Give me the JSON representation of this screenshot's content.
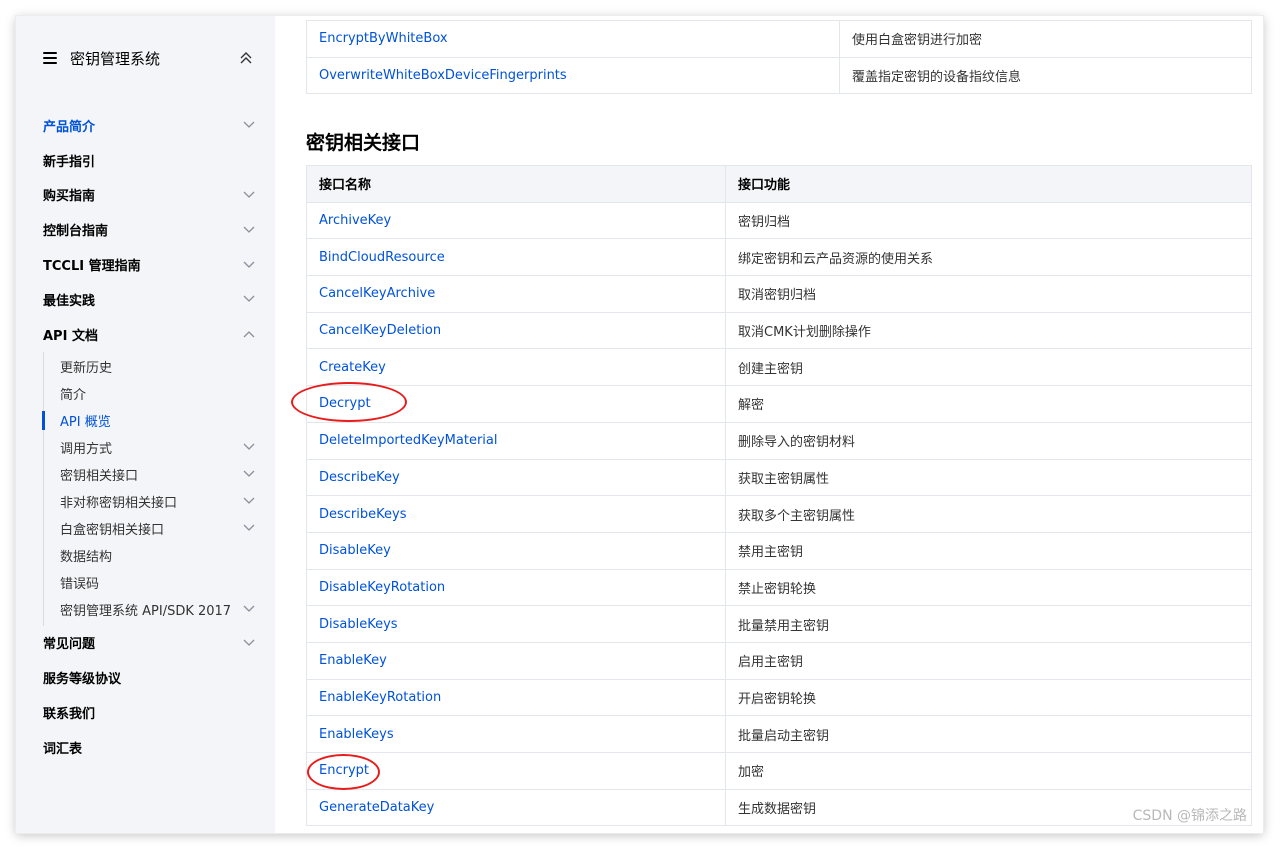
{
  "sidebar": {
    "title": "密钥管理系统",
    "items": [
      {
        "label": "产品简介",
        "active": true,
        "chevron": "down"
      },
      {
        "label": "新手指引",
        "chevron": ""
      },
      {
        "label": "购买指南",
        "chevron": "down"
      },
      {
        "label": "控制台指南",
        "chevron": "down"
      },
      {
        "label": "TCCLI 管理指南",
        "chevron": "down"
      },
      {
        "label": "最佳实践",
        "chevron": "down"
      },
      {
        "label": "API 文档",
        "chevron": "up"
      },
      {
        "label": "常见问题",
        "chevron": "down"
      },
      {
        "label": "服务等级协议",
        "chevron": ""
      },
      {
        "label": "联系我们",
        "chevron": ""
      },
      {
        "label": "词汇表",
        "chevron": ""
      }
    ],
    "api_sub_items": [
      {
        "label": "更新历史",
        "chevron": ""
      },
      {
        "label": "简介",
        "chevron": ""
      },
      {
        "label": "API 概览",
        "active": true,
        "chevron": ""
      },
      {
        "label": "调用方式",
        "chevron": "down"
      },
      {
        "label": "密钥相关接口",
        "chevron": "down"
      },
      {
        "label": "非对称密钥相关接口",
        "chevron": "down"
      },
      {
        "label": "白盒密钥相关接口",
        "chevron": "down"
      },
      {
        "label": "数据结构",
        "chevron": ""
      },
      {
        "label": "错误码",
        "chevron": ""
      },
      {
        "label": "密钥管理系统 API/SDK 2017",
        "chevron": "down"
      }
    ]
  },
  "top_table": {
    "rows": [
      {
        "name": "EncryptByWhiteBox",
        "desc": "使用白盒密钥进行加密"
      },
      {
        "name": "OverwriteWhiteBoxDeviceFingerprints",
        "desc": "覆盖指定密钥的设备指纹信息"
      }
    ]
  },
  "section": {
    "title": "密钥相关接口",
    "columns": [
      "接口名称",
      "接口功能"
    ],
    "rows": [
      {
        "name": "ArchiveKey",
        "desc": "密钥归档"
      },
      {
        "name": "BindCloudResource",
        "desc": "绑定密钥和云产品资源的使用关系"
      },
      {
        "name": "CancelKeyArchive",
        "desc": "取消密钥归档"
      },
      {
        "name": "CancelKeyDeletion",
        "desc": "取消CMK计划删除操作"
      },
      {
        "name": "CreateKey",
        "desc": "创建主密钥"
      },
      {
        "name": "Decrypt",
        "desc": "解密",
        "highlight": true
      },
      {
        "name": "DeleteImportedKeyMaterial",
        "desc": "删除导入的密钥材料"
      },
      {
        "name": "DescribeKey",
        "desc": "获取主密钥属性"
      },
      {
        "name": "DescribeKeys",
        "desc": "获取多个主密钥属性"
      },
      {
        "name": "DisableKey",
        "desc": "禁用主密钥"
      },
      {
        "name": "DisableKeyRotation",
        "desc": "禁止密钥轮换"
      },
      {
        "name": "DisableKeys",
        "desc": "批量禁用主密钥"
      },
      {
        "name": "EnableKey",
        "desc": "启用主密钥"
      },
      {
        "name": "EnableKeyRotation",
        "desc": "开启密钥轮换"
      },
      {
        "name": "EnableKeys",
        "desc": "批量启动主密钥"
      },
      {
        "name": "Encrypt",
        "desc": "加密",
        "highlight": true
      },
      {
        "name": "GenerateDataKey",
        "desc": "生成数据密钥"
      }
    ]
  },
  "colors": {
    "link": "#0052d9",
    "annotation": "#e81c1c",
    "sidebar_bg": "#f3f5f8"
  },
  "watermark": "CSDN @锦添之路"
}
